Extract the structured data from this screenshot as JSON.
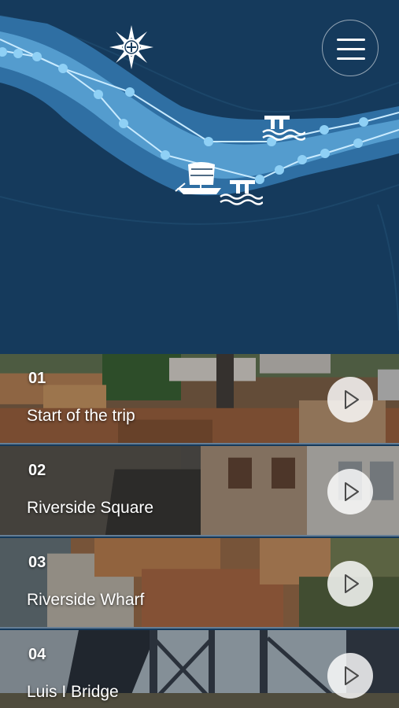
{
  "map": {
    "colors": {
      "background": "#153a5c",
      "river_outer": "#2f6fa3",
      "river_inner": "#5aa4d6",
      "route": "#8fd0f5",
      "icon": "#ffffff"
    },
    "icons": {
      "compass": "compass-icon",
      "menu": "hamburger-menu-icon",
      "boat": "rabelo-boat-icon",
      "pier": "pier-icon"
    }
  },
  "stops": [
    {
      "number": "01",
      "title": "Start of the trip",
      "icon": "play-icon"
    },
    {
      "number": "02",
      "title": "Riverside Square",
      "icon": "play-icon"
    },
    {
      "number": "03",
      "title": "Riverside Wharf",
      "icon": "play-icon"
    },
    {
      "number": "04",
      "title": "Luis I Bridge",
      "icon": "play-icon"
    }
  ]
}
